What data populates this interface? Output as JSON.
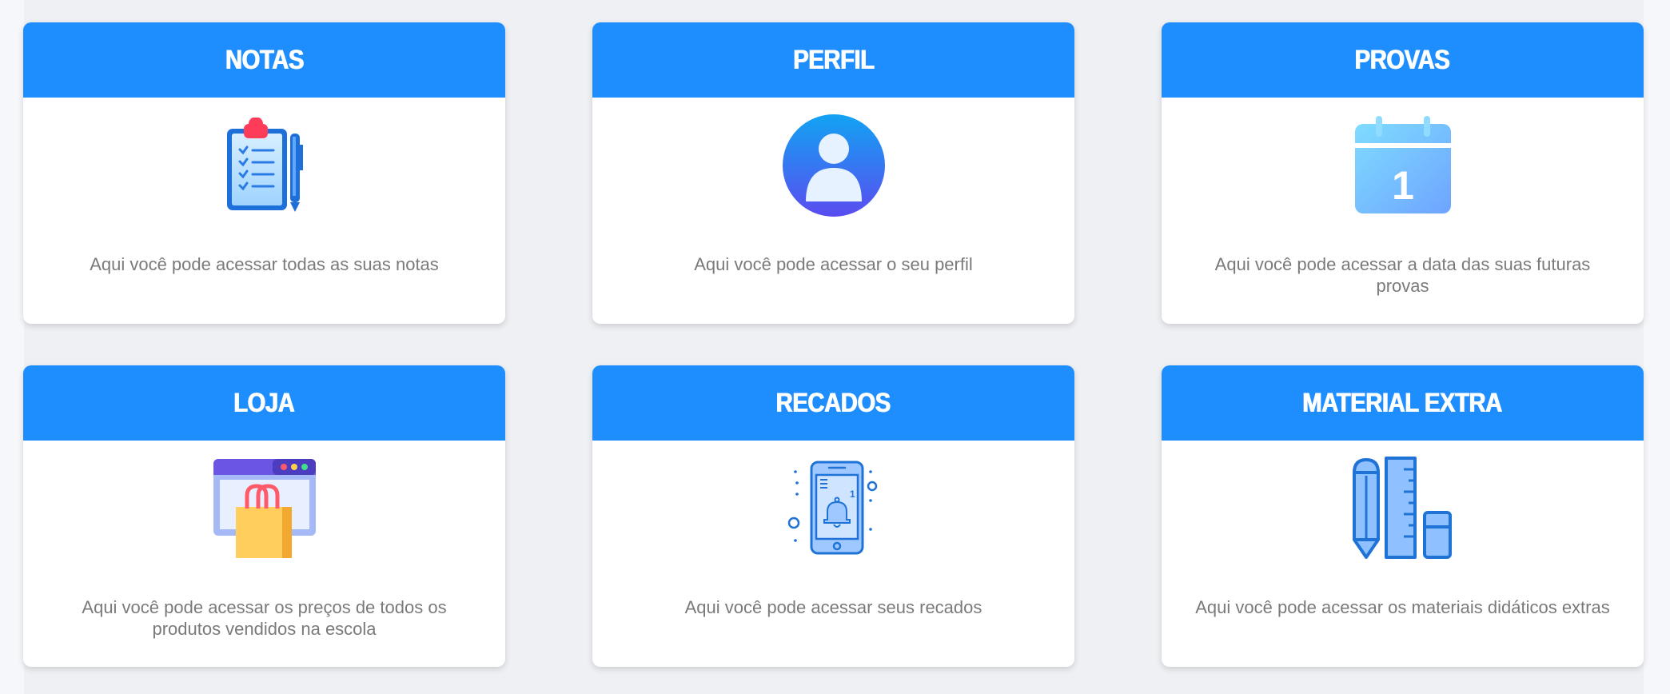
{
  "cards": [
    {
      "title": "NOTAS",
      "icon": "clipboard-checklist-icon",
      "description": "Aqui você pode acessar todas as suas notas"
    },
    {
      "title": "PERFIL",
      "icon": "user-profile-icon",
      "description": "Aqui você pode acessar o seu perfil"
    },
    {
      "title": "PROVAS",
      "icon": "calendar-icon",
      "description": "Aqui você pode acessar a data das suas futuras provas"
    },
    {
      "title": "LOJA",
      "icon": "shopping-bag-icon",
      "description": "Aqui você pode acessar os preços de todos os produtos vendidos na escola"
    },
    {
      "title": "RECADOS",
      "icon": "phone-notification-icon",
      "description": "Aqui você pode acessar seus recados"
    },
    {
      "title": "MATERIAL EXTRA",
      "icon": "school-supplies-icon",
      "description": "Aqui você pode acessar os materiais didáticos extras"
    }
  ],
  "colors": {
    "header": "#1e8eff",
    "background": "#eef0f4",
    "description_text": "#7a7a7a"
  }
}
